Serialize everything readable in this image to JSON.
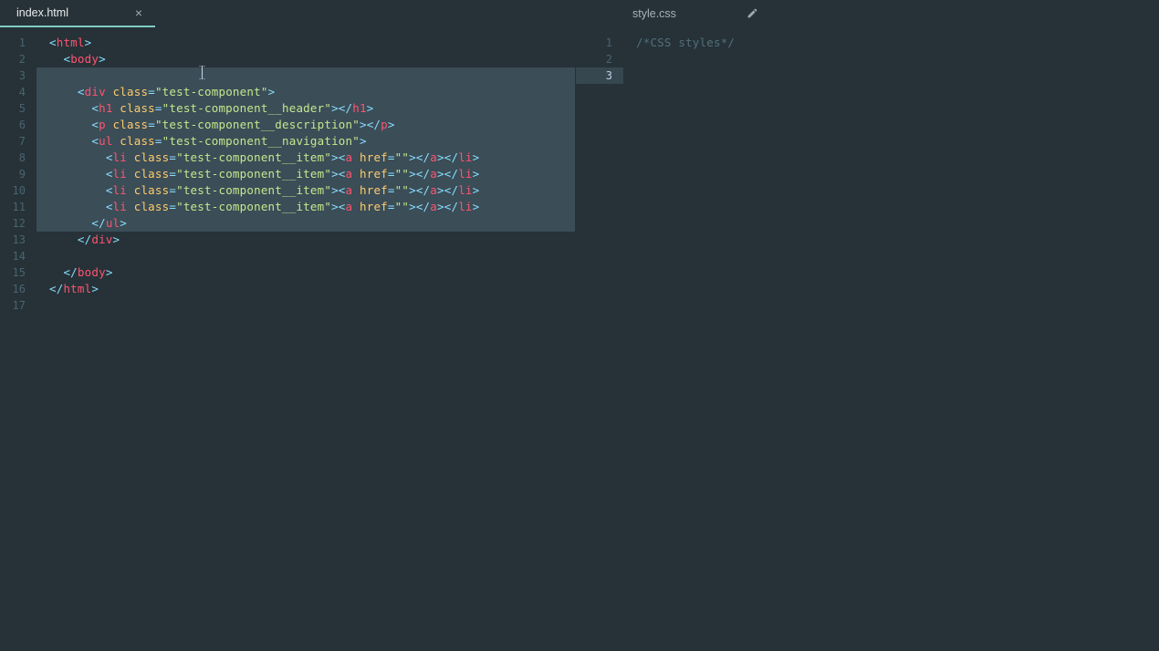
{
  "tabs": {
    "left": {
      "title": "index.html",
      "icon": "close"
    },
    "right": {
      "title": "style.css",
      "icon": "pencil"
    }
  },
  "leftEditor": {
    "lineCount": 17,
    "selection": {
      "from": 3,
      "to": 12
    },
    "cursorLine": 3,
    "lines": [
      [
        [
          "p",
          "<"
        ],
        [
          "t",
          "html"
        ],
        [
          "p",
          ">"
        ]
      ],
      [
        [
          "e",
          "  "
        ],
        [
          "p",
          "<"
        ],
        [
          "t",
          "body"
        ],
        [
          "p",
          ">"
        ]
      ],
      [
        [
          "e",
          ""
        ]
      ],
      [
        [
          "e",
          "    "
        ],
        [
          "p",
          "<"
        ],
        [
          "t",
          "div"
        ],
        [
          "e",
          " "
        ],
        [
          "a",
          "class"
        ],
        [
          "p",
          "="
        ],
        [
          "s",
          "\"test-component\""
        ],
        [
          "p",
          ">"
        ]
      ],
      [
        [
          "e",
          "      "
        ],
        [
          "p",
          "<"
        ],
        [
          "t",
          "h1"
        ],
        [
          "e",
          " "
        ],
        [
          "a",
          "class"
        ],
        [
          "p",
          "="
        ],
        [
          "s",
          "\"test-component__header\""
        ],
        [
          "p",
          "></"
        ],
        [
          "t",
          "h1"
        ],
        [
          "p",
          ">"
        ]
      ],
      [
        [
          "e",
          "      "
        ],
        [
          "p",
          "<"
        ],
        [
          "t",
          "p"
        ],
        [
          "e",
          " "
        ],
        [
          "a",
          "class"
        ],
        [
          "p",
          "="
        ],
        [
          "s",
          "\"test-component__description\""
        ],
        [
          "p",
          "></"
        ],
        [
          "t",
          "p"
        ],
        [
          "p",
          ">"
        ]
      ],
      [
        [
          "e",
          "      "
        ],
        [
          "p",
          "<"
        ],
        [
          "t",
          "ul"
        ],
        [
          "e",
          " "
        ],
        [
          "a",
          "class"
        ],
        [
          "p",
          "="
        ],
        [
          "s",
          "\"test-component__navigation\""
        ],
        [
          "p",
          ">"
        ]
      ],
      [
        [
          "e",
          "        "
        ],
        [
          "p",
          "<"
        ],
        [
          "t",
          "li"
        ],
        [
          "e",
          " "
        ],
        [
          "a",
          "class"
        ],
        [
          "p",
          "="
        ],
        [
          "s",
          "\"test-component__item\""
        ],
        [
          "p",
          "><"
        ],
        [
          "t",
          "a"
        ],
        [
          "e",
          " "
        ],
        [
          "a",
          "href"
        ],
        [
          "p",
          "="
        ],
        [
          "s",
          "\"\""
        ],
        [
          "p",
          "></"
        ],
        [
          "t",
          "a"
        ],
        [
          "p",
          "></"
        ],
        [
          "t",
          "li"
        ],
        [
          "p",
          ">"
        ]
      ],
      [
        [
          "e",
          "        "
        ],
        [
          "p",
          "<"
        ],
        [
          "t",
          "li"
        ],
        [
          "e",
          " "
        ],
        [
          "a",
          "class"
        ],
        [
          "p",
          "="
        ],
        [
          "s",
          "\"test-component__item\""
        ],
        [
          "p",
          "><"
        ],
        [
          "t",
          "a"
        ],
        [
          "e",
          " "
        ],
        [
          "a",
          "href"
        ],
        [
          "p",
          "="
        ],
        [
          "s",
          "\"\""
        ],
        [
          "p",
          "></"
        ],
        [
          "t",
          "a"
        ],
        [
          "p",
          "></"
        ],
        [
          "t",
          "li"
        ],
        [
          "p",
          ">"
        ]
      ],
      [
        [
          "e",
          "        "
        ],
        [
          "p",
          "<"
        ],
        [
          "t",
          "li"
        ],
        [
          "e",
          " "
        ],
        [
          "a",
          "class"
        ],
        [
          "p",
          "="
        ],
        [
          "s",
          "\"test-component__item\""
        ],
        [
          "p",
          "><"
        ],
        [
          "t",
          "a"
        ],
        [
          "e",
          " "
        ],
        [
          "a",
          "href"
        ],
        [
          "p",
          "="
        ],
        [
          "s",
          "\"\""
        ],
        [
          "p",
          "></"
        ],
        [
          "t",
          "a"
        ],
        [
          "p",
          "></"
        ],
        [
          "t",
          "li"
        ],
        [
          "p",
          ">"
        ]
      ],
      [
        [
          "e",
          "        "
        ],
        [
          "p",
          "<"
        ],
        [
          "t",
          "li"
        ],
        [
          "e",
          " "
        ],
        [
          "a",
          "class"
        ],
        [
          "p",
          "="
        ],
        [
          "s",
          "\"test-component__item\""
        ],
        [
          "p",
          "><"
        ],
        [
          "t",
          "a"
        ],
        [
          "e",
          " "
        ],
        [
          "a",
          "href"
        ],
        [
          "p",
          "="
        ],
        [
          "s",
          "\"\""
        ],
        [
          "p",
          "></"
        ],
        [
          "t",
          "a"
        ],
        [
          "p",
          "></"
        ],
        [
          "t",
          "li"
        ],
        [
          "p",
          ">"
        ]
      ],
      [
        [
          "e",
          "      "
        ],
        [
          "p",
          "</"
        ],
        [
          "t",
          "ul"
        ],
        [
          "p",
          ">"
        ]
      ],
      [
        [
          "e",
          "    "
        ],
        [
          "p",
          "</"
        ],
        [
          "t",
          "div"
        ],
        [
          "p",
          ">"
        ]
      ],
      [
        [
          "e",
          ""
        ]
      ],
      [
        [
          "e",
          "  "
        ],
        [
          "p",
          "</"
        ],
        [
          "t",
          "body"
        ],
        [
          "p",
          ">"
        ]
      ],
      [
        [
          "p",
          "</"
        ],
        [
          "t",
          "html"
        ],
        [
          "p",
          ">"
        ]
      ],
      [
        [
          "e",
          ""
        ]
      ]
    ]
  },
  "rightEditor": {
    "lineCount": 3,
    "activeLine": 3,
    "lines": [
      [
        [
          "c",
          "/*CSS styles*/"
        ]
      ],
      [
        [
          "e",
          ""
        ]
      ],
      [
        [
          "e",
          ""
        ]
      ]
    ]
  }
}
